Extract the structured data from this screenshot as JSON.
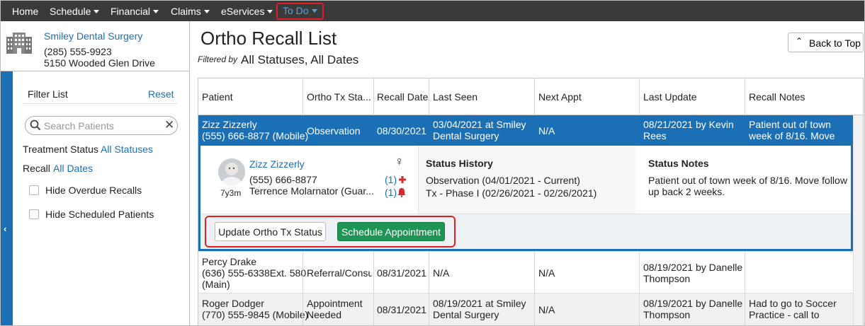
{
  "topnav": {
    "items": [
      {
        "label": "Home"
      },
      {
        "label": "Schedule"
      },
      {
        "label": "Financial"
      },
      {
        "label": "Claims"
      },
      {
        "label": "eServices"
      },
      {
        "label": "To Do"
      }
    ]
  },
  "practice": {
    "name": "Smiley Dental Surgery",
    "phone": "(285) 555-9923",
    "address": "5150 Wooded Glen Drive",
    "icon": "building-icon"
  },
  "filters": {
    "title": "Filter List",
    "reset": "Reset",
    "search_placeholder": "Search Patients",
    "treatment_status_label": "Treatment Status",
    "treatment_status_value": "All Statuses",
    "recall_label": "Recall",
    "recall_value": "All Dates",
    "hide_overdue": "Hide Overdue Recalls",
    "hide_scheduled": "Hide Scheduled Patients"
  },
  "page": {
    "title": "Ortho Recall List",
    "filtered_by_label": "Filtered by",
    "filtered_by_value": "All Statuses, All Dates",
    "back_to_top": "Back to Top"
  },
  "table": {
    "columns": [
      "Patient",
      "Ortho Tx Sta...",
      "Recall Date",
      "Last Seen",
      "Next Appt",
      "Last Update",
      "Recall Notes"
    ],
    "selected": {
      "patient_name": "Zizz Zizzerly",
      "patient_phone": "(555) 666-8877 (Mobile)",
      "status": "Observation",
      "recall_date": "08/30/2021",
      "last_seen_1": "03/04/2021 at Smiley",
      "last_seen_2": "Dental Surgery",
      "next_appt": "N/A",
      "last_update_1": "08/21/2021 by Kevin",
      "last_update_2": "Rees",
      "notes_1": "Patient out of town",
      "notes_2": "week of 8/16. Move"
    },
    "detail": {
      "name": "Zizz Zizzerly",
      "phone": "(555) 666-8877",
      "responsible": "Terrence Molarnator (Guar...",
      "age": "7y3m",
      "medical_alert_count": "(1)",
      "alert_count": "(1)",
      "status_history_title": "Status History",
      "history_1": "Observation (04/01/2021 - Current)",
      "history_2": "Tx - Phase I (02/26/2021 - 02/26/2021)",
      "status_notes_title": "Status Notes",
      "notes_1": "Patient out of town week of 8/16. Move follow",
      "notes_2": "up back 2 weeks.",
      "update_btn": "Update Ortho Tx Status",
      "schedule_btn": "Schedule Appointment"
    },
    "rows": [
      {
        "patient_name": "Percy Drake",
        "patient_phone": "(636) 555-6338Ext. 580",
        "patient_phone_2": "(Main)",
        "status": "Referral/Consu",
        "recall_date": "08/31/2021",
        "last_seen": "N/A",
        "next_appt": "N/A",
        "last_update_1": "08/19/2021 by Danelle",
        "last_update_2": "Thompson",
        "notes_1": "",
        "notes_2": ""
      },
      {
        "patient_name": "Roger Dodger",
        "patient_phone": "(770) 555-9845 (Mobile)",
        "status_1": "Appointment",
        "status_2": "Needed",
        "recall_date": "08/31/2021",
        "last_seen_1": "08/19/2021 at Smiley",
        "last_seen_2": "Dental Surgery",
        "next_appt": "N/A",
        "last_update_1": "08/19/2021 by Danelle",
        "last_update_2": "Thompson",
        "notes_1": "Had to go to Soccer",
        "notes_2": "Practice - call to"
      }
    ]
  },
  "colors": {
    "nav_bg": "#3a3a3a",
    "accent": "#1a6fb5",
    "selected_row": "#1a6fb5",
    "primary_button": "#1e9555",
    "highlight": "#e02020",
    "alert_red": "#d6282f"
  }
}
